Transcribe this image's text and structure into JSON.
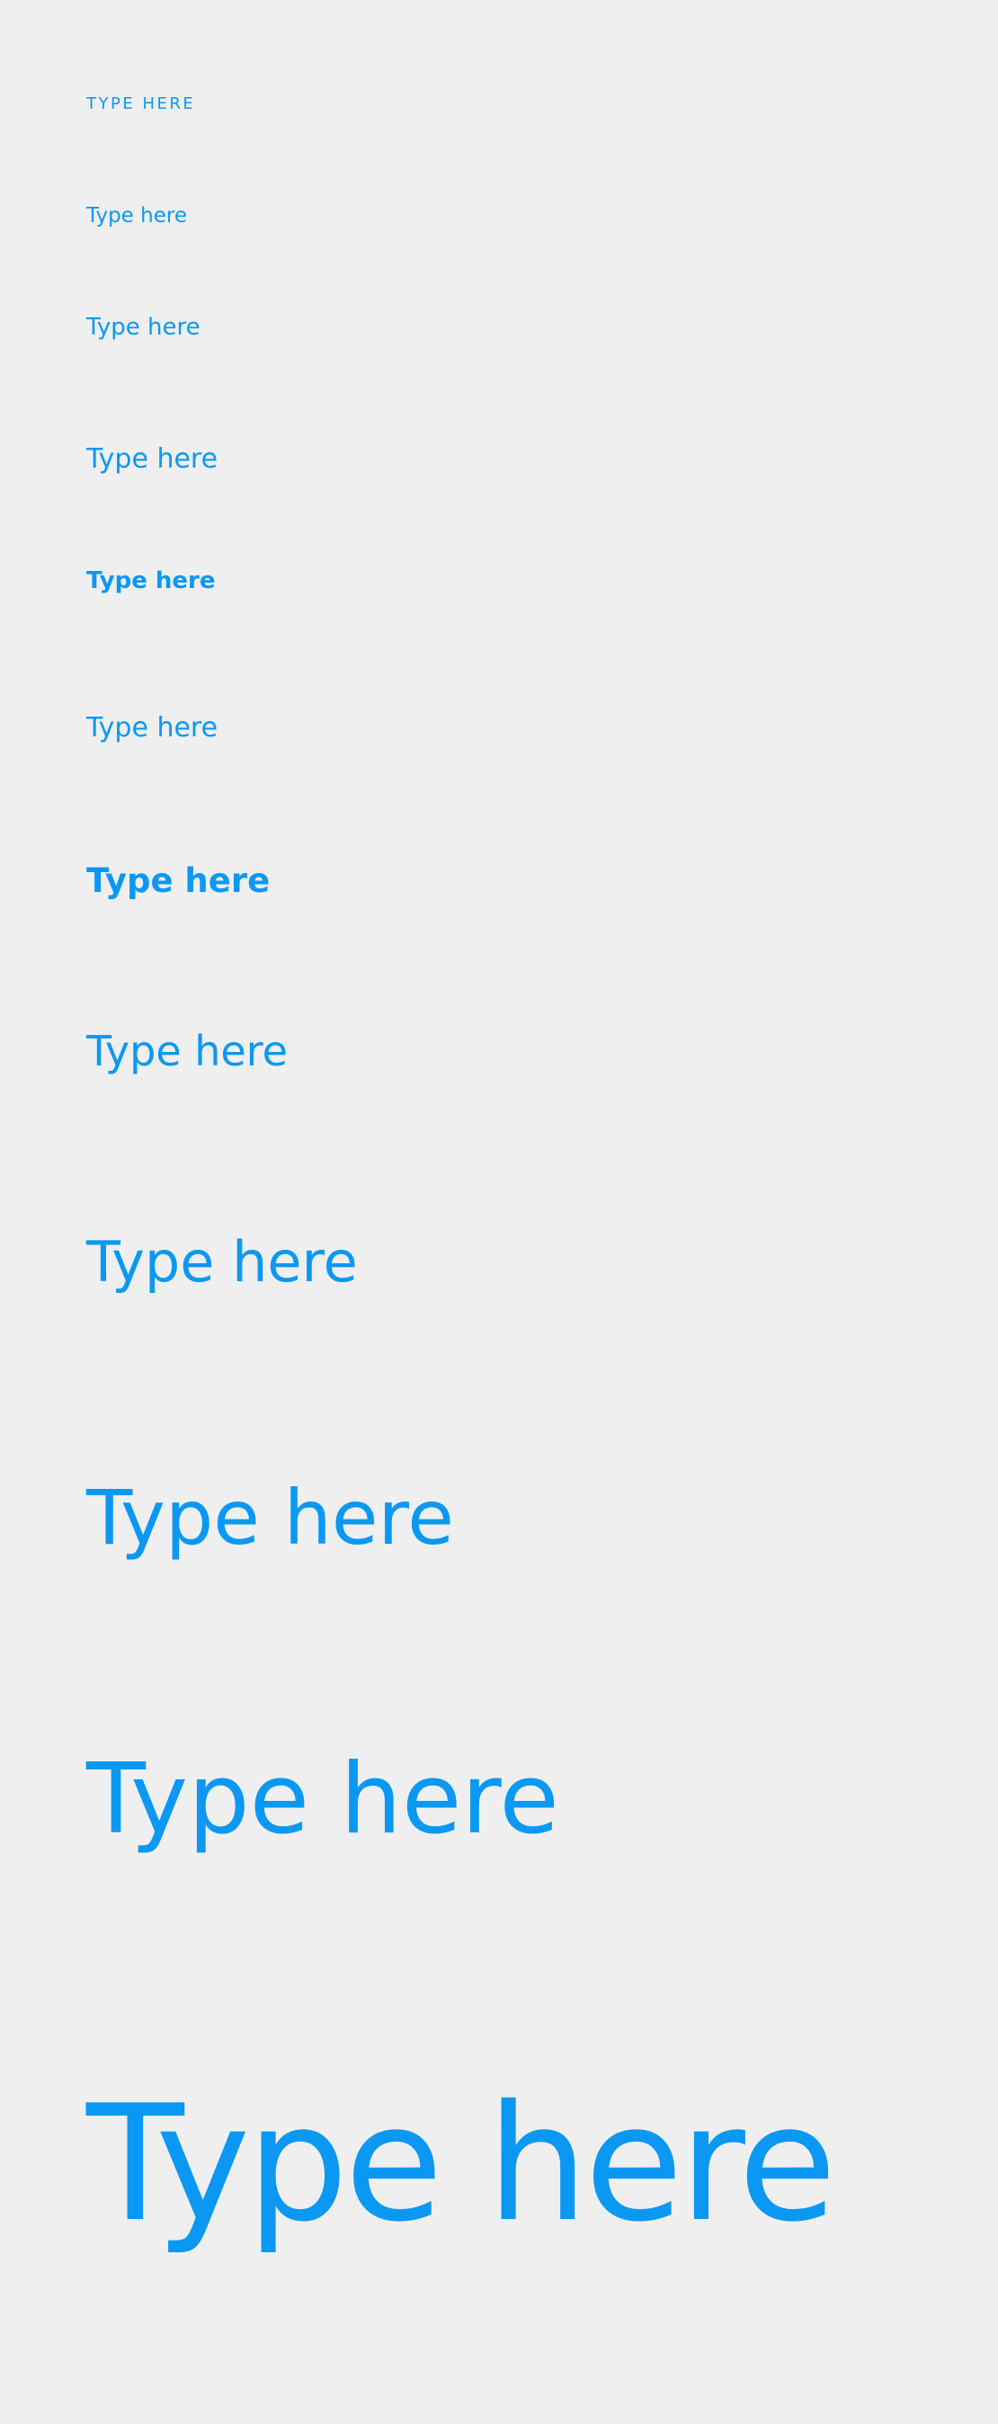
{
  "theme": {
    "background": "#efefef",
    "accent": "#0b98f2"
  },
  "specimens": [
    {
      "text": "TYPE HERE",
      "style": "caption-uppercase"
    },
    {
      "text": "Type here",
      "style": "body-small"
    },
    {
      "text": "Type here",
      "style": "body"
    },
    {
      "text": "Type here",
      "style": "body-large"
    },
    {
      "text": "Type here",
      "style": "body-bold"
    },
    {
      "text": "Type here",
      "style": "subheading"
    },
    {
      "text": "Type here",
      "style": "subheading-bold"
    },
    {
      "text": "Type here",
      "style": "heading-6"
    },
    {
      "text": "Type here",
      "style": "heading-5"
    },
    {
      "text": "Type here",
      "style": "heading-4"
    },
    {
      "text": "Type here",
      "style": "heading-3"
    },
    {
      "text": "Type here",
      "style": "display"
    }
  ]
}
